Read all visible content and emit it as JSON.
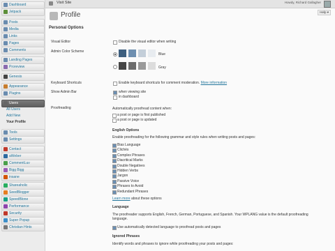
{
  "sidebar": {
    "items": [
      {
        "label": "Dashboard",
        "icon": "dashboard-icon"
      },
      {
        "label": "Jetpack",
        "icon": "jetpack-icon"
      },
      {
        "label": "Posts",
        "icon": "posts-icon"
      },
      {
        "label": "Media",
        "icon": "media-icon"
      },
      {
        "label": "Links",
        "icon": "links-icon"
      },
      {
        "label": "Pages",
        "icon": "pages-icon"
      },
      {
        "label": "Comments",
        "icon": "comments-icon"
      },
      {
        "label": "Landing Pages",
        "icon": "landing-pages-icon"
      },
      {
        "label": "Proreview",
        "icon": "proreview-icon"
      },
      {
        "label": "Genesis",
        "icon": "genesis-icon"
      },
      {
        "label": "Appearance",
        "icon": "appearance-icon"
      },
      {
        "label": "Plugins",
        "icon": "plugins-icon"
      },
      {
        "label": "Users",
        "icon": "users-icon"
      },
      {
        "label": "Tools",
        "icon": "tools-icon"
      },
      {
        "label": "Settings",
        "icon": "settings-icon"
      },
      {
        "label": "Contact",
        "icon": "contact-icon"
      },
      {
        "label": "aWeber",
        "icon": "aweber-icon"
      },
      {
        "label": "CommentLuv",
        "icon": "commentluv-icon"
      },
      {
        "label": "Bigg Bigg",
        "icon": "bigg-icon"
      },
      {
        "label": "insane",
        "icon": "insane-icon"
      },
      {
        "label": "Shareaholic",
        "icon": "shareaholic-icon"
      },
      {
        "label": "SeedBlogger",
        "icon": "seedblogger-icon"
      },
      {
        "label": "SpeedBlone",
        "icon": "speedblone-icon"
      },
      {
        "label": "Performance",
        "icon": "performance-icon"
      },
      {
        "label": "Security",
        "icon": "security-icon"
      },
      {
        "label": "Super Popup",
        "icon": "super-popup-icon"
      },
      {
        "label": "Christian Hints",
        "icon": "christian-hints-icon"
      }
    ],
    "users_sub": [
      "All Users",
      "Add New",
      "Your Profile"
    ]
  },
  "topbar": {
    "site_link": "Visit Site",
    "greeting": "Howdy, Richard Gallagher"
  },
  "page": {
    "title": "Profile",
    "help": "Help ▾"
  },
  "personal_options": "Personal Options",
  "visual_editor": {
    "label": "Visual Editor",
    "option": "Disable the visual editor when writing"
  },
  "color_scheme": {
    "label": "Admin Color Scheme",
    "option1": "Blue",
    "option2": "Gray",
    "blue_colors": [
      "#3e5f7f",
      "#6e8fb0",
      "#c3ced9",
      "#e8ecf0"
    ],
    "gray_colors": [
      "#464646",
      "#6d6d6d",
      "#9a9a9a",
      "#dcdcdc"
    ]
  },
  "keyboard": {
    "label": "Keyboard Shortcuts",
    "option": "Enable keyboard shortcuts for comment moderation.",
    "link": "More information"
  },
  "toolbar": {
    "label": "Show Admin Bar",
    "opt1": "when viewing site",
    "opt2": "in dashboard"
  },
  "proofreading": {
    "label": "Proofreading",
    "auto_text": "Automatically proofread content when:",
    "auto_opts": [
      "a post or page is first published",
      "a post or page is updated"
    ],
    "english_header": "English Options",
    "english_text": "Enable proofreading for the following grammar and style rules when writing posts and pages:",
    "rules": [
      "Bias Language",
      "Clichés",
      "Complex Phrases",
      "Diacritical Marks",
      "Double Negatives",
      "Hidden Verbs",
      "Jargon",
      "Passive Voice",
      "Phrases to Avoid",
      "Redundant Phrases"
    ],
    "learn_more": "Learn more",
    "learn_more_suffix": "about these options",
    "language_header": "Language",
    "language_text": "The proofreader supports English, French, German, Portuguese, and Spanish. Your WPLANG value is the default proofreading language.",
    "language_opt": "Use automatically detected language to proofread posts and pages",
    "ignored_header": "Ignored Phrases",
    "ignored_text": "Identify words and phrases to ignore while proofreading your posts and pages:"
  }
}
